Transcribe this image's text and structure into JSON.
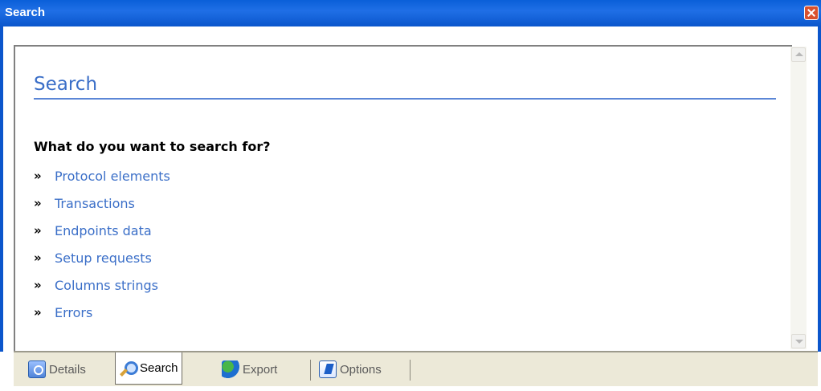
{
  "window": {
    "title": "Search"
  },
  "content": {
    "heading": "Search",
    "question": "What do you want to search for?",
    "bullet": "»",
    "links": [
      {
        "label": "Protocol elements"
      },
      {
        "label": "Transactions"
      },
      {
        "label": "Endpoints data"
      },
      {
        "label": "Setup requests"
      },
      {
        "label": "Columns strings"
      },
      {
        "label": "Errors"
      }
    ]
  },
  "tabs": [
    {
      "label": "Details",
      "icon": "details-icon",
      "active": false
    },
    {
      "label": "Search",
      "icon": "search-icon",
      "active": true
    },
    {
      "label": "Export",
      "icon": "export-icon",
      "active": false
    },
    {
      "label": "Options",
      "icon": "options-icon",
      "active": false
    }
  ],
  "colors": {
    "titlebar": "#0b56cc",
    "link": "#3b6fc8",
    "tabstrip": "#ece9d8",
    "close": "#d9512e"
  }
}
